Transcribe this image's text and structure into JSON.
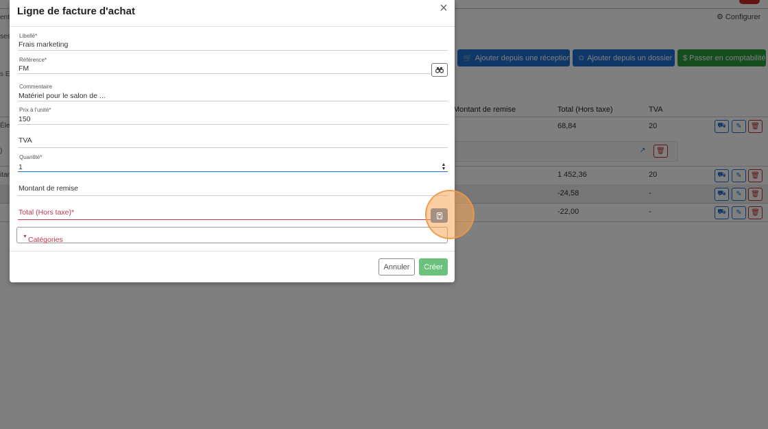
{
  "background": {
    "left_texts": [
      "ents",
      "ses",
      "s E",
      "Élec",
      ")",
      "itan"
    ],
    "configure_label": "Configurer",
    "buttons": {
      "add_from_reception": "Ajouter depuis une réception",
      "add_from_folder": "Ajouter depuis un dossier",
      "post_accounting": "$ Passer en comptabilité"
    },
    "table": {
      "headers": [
        "Montant de remise",
        "Total (Hors taxe)",
        "TVA"
      ],
      "rows": [
        {
          "total": "68,84",
          "tva": "20"
        },
        {
          "total": "1 452,36",
          "tva": "20"
        },
        {
          "total": "-24,58",
          "tva": "-"
        },
        {
          "total": "-22,00",
          "tva": "-"
        }
      ]
    }
  },
  "modal": {
    "title": "Ligne de facture d'achat",
    "close_icon": "close-icon",
    "fields": {
      "libelle": {
        "label": "Libellé*",
        "value": "Frais marketing"
      },
      "reference": {
        "label": "Référence*",
        "value": "FM"
      },
      "commentaire": {
        "label": "Commentaire",
        "value": "Matériel pour le salon de ..."
      },
      "prix": {
        "label": "Prix à l'unité*",
        "value": "150"
      },
      "tva": {
        "placeholder": "TVA"
      },
      "quantite": {
        "label": "Quantité*",
        "value": "1"
      },
      "remise": {
        "placeholder": "Montant de remise"
      },
      "total": {
        "placeholder": "Total (Hors taxe)*"
      }
    },
    "categories_label": "Catégories",
    "cancel_label": "Annuler",
    "create_label": "Créer"
  },
  "colors": {
    "overlay": "rgba(0,0,0,0.5)",
    "primary": "#1f6fd0",
    "success": "#2a9a3c",
    "danger": "#c03546",
    "create_disabled": "#6cc27c",
    "click_highlight": "#f7a858"
  }
}
